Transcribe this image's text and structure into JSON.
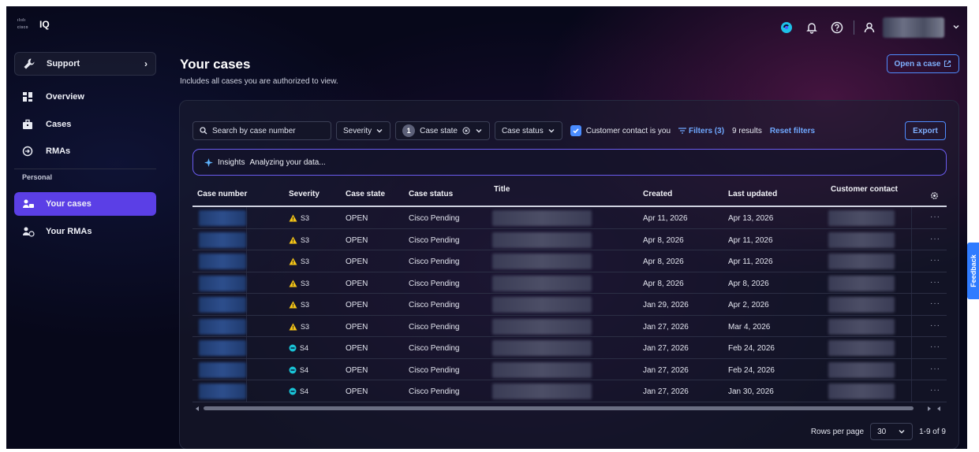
{
  "app": {
    "brand": "IQ",
    "cisco_mark": "cisco"
  },
  "colors": {
    "accent": "#5b3fe6",
    "link": "#6fa8ff",
    "warning": "#f5c518",
    "low": "#19c3d6",
    "feedback": "#2f7bff"
  },
  "sidebar": {
    "support": "Support",
    "items": [
      {
        "label": "Overview",
        "icon": "grid-icon"
      },
      {
        "label": "Cases",
        "icon": "briefcase-icon"
      },
      {
        "label": "RMAs",
        "icon": "return-icon"
      }
    ],
    "personal_label": "Personal",
    "personal_items": [
      {
        "label": "Your cases",
        "icon": "user-case-icon",
        "active": true
      },
      {
        "label": "Your RMAs",
        "icon": "user-rma-icon"
      }
    ]
  },
  "header": {
    "title": "Your cases",
    "subtitle": "Includes all cases you are authorized to view.",
    "open_case": "Open a case"
  },
  "filters": {
    "search_placeholder": "Search by case number",
    "severity": "Severity",
    "case_state_count": "1",
    "case_state": "Case state",
    "case_status": "Case status",
    "customer_contact": "Customer contact is you",
    "filters_link": "Filters (3)",
    "results": "9 results",
    "reset": "Reset filters",
    "export": "Export"
  },
  "insights": {
    "label": "Insights",
    "text": "Analyzing your data..."
  },
  "table": {
    "headers": [
      "Case number",
      "Severity",
      "Case state",
      "Case status",
      "Title",
      "Created",
      "Last updated",
      "Customer contact"
    ],
    "rows": [
      {
        "severity": "S3",
        "level": "warn",
        "state": "OPEN",
        "status": "Cisco Pending",
        "created": "Apr 11, 2026",
        "updated": "Apr 13, 2026"
      },
      {
        "severity": "S3",
        "level": "warn",
        "state": "OPEN",
        "status": "Cisco Pending",
        "created": "Apr 8, 2026",
        "updated": "Apr 11, 2026"
      },
      {
        "severity": "S3",
        "level": "warn",
        "state": "OPEN",
        "status": "Cisco Pending",
        "created": "Apr 8, 2026",
        "updated": "Apr 11, 2026"
      },
      {
        "severity": "S3",
        "level": "warn",
        "state": "OPEN",
        "status": "Cisco Pending",
        "created": "Apr 8, 2026",
        "updated": "Apr 8, 2026"
      },
      {
        "severity": "S3",
        "level": "warn",
        "state": "OPEN",
        "status": "Cisco Pending",
        "created": "Jan 29, 2026",
        "updated": "Apr 2, 2026"
      },
      {
        "severity": "S3",
        "level": "warn",
        "state": "OPEN",
        "status": "Cisco Pending",
        "created": "Jan 27, 2026",
        "updated": "Mar 4, 2026"
      },
      {
        "severity": "S4",
        "level": "low",
        "state": "OPEN",
        "status": "Cisco Pending",
        "created": "Jan 27, 2026",
        "updated": "Feb 24, 2026"
      },
      {
        "severity": "S4",
        "level": "low",
        "state": "OPEN",
        "status": "Cisco Pending",
        "created": "Jan 27, 2026",
        "updated": "Feb 24, 2026"
      },
      {
        "severity": "S4",
        "level": "low",
        "state": "OPEN",
        "status": "Cisco Pending",
        "created": "Jan 27, 2026",
        "updated": "Jan 30, 2026"
      }
    ],
    "row_more": "···"
  },
  "pagination": {
    "rows_per_page_label": "Rows per page",
    "rows_per_page": "30",
    "range": "1-9 of 9"
  },
  "feedback": "Feedback"
}
